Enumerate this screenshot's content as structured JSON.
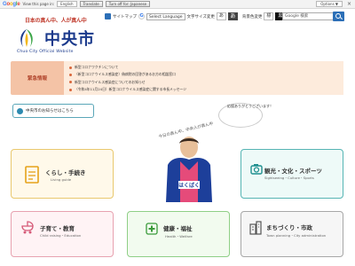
{
  "translate_bar": {
    "brand": "Google",
    "prompt": "View this page in:",
    "language": "English",
    "translate_btn": "Translate",
    "turn_off": "Turn off for: Japanese",
    "options": "Options ▼",
    "close": "×"
  },
  "header": {
    "tagline": "日本の真ん中、人が真ん中",
    "logo_text": "中央市",
    "logo_sub": "Chuo City Official Website",
    "sitemap": "サイトマップ",
    "translate_select": "Select Language",
    "font_size_label": "文字サイズ変更",
    "font_sizes": [
      "あ",
      "あ"
    ],
    "contrast_label": "背景色変更",
    "contrast": [
      "標",
      "黒",
      "青"
    ],
    "search_value": "Google 検索"
  },
  "emergency": {
    "label": "緊急情報",
    "items": [
      "新型コロナワクチンについて",
      "（新型コロナウイルス感染症）偽病院の回答があるお方の相談窓口",
      "新型コロナウイルス感染症についてのお知らせ",
      "（令和4年11月24日）新型コロナウイルス感染症に関する市長メッセージ"
    ]
  },
  "news_button": "中央市のお知らせはこちら",
  "mascot": {
    "bubble_text": "応援ありがとうございます！",
    "arc_text": "今日の真ん中、中央人が真ん中"
  },
  "cards": {
    "kurashi": {
      "title": "くらし・手続き",
      "sub": "Living guide",
      "color": "#e5a21a"
    },
    "kanko": {
      "title": "観光・文化・スポーツ",
      "sub": "Sightseeing・Culture・Sports",
      "color": "#1f8f8f"
    },
    "kosodate": {
      "title": "子育て・教育",
      "sub": "Child raising・Education",
      "color": "#d65a78"
    },
    "kenko": {
      "title": "健康・福祉",
      "sub": "Health・Welfare",
      "color": "#3a9b3a"
    },
    "machi": {
      "title": "まちづくり・市政",
      "sub": "Town planning・City administration",
      "color": "#555555"
    }
  }
}
